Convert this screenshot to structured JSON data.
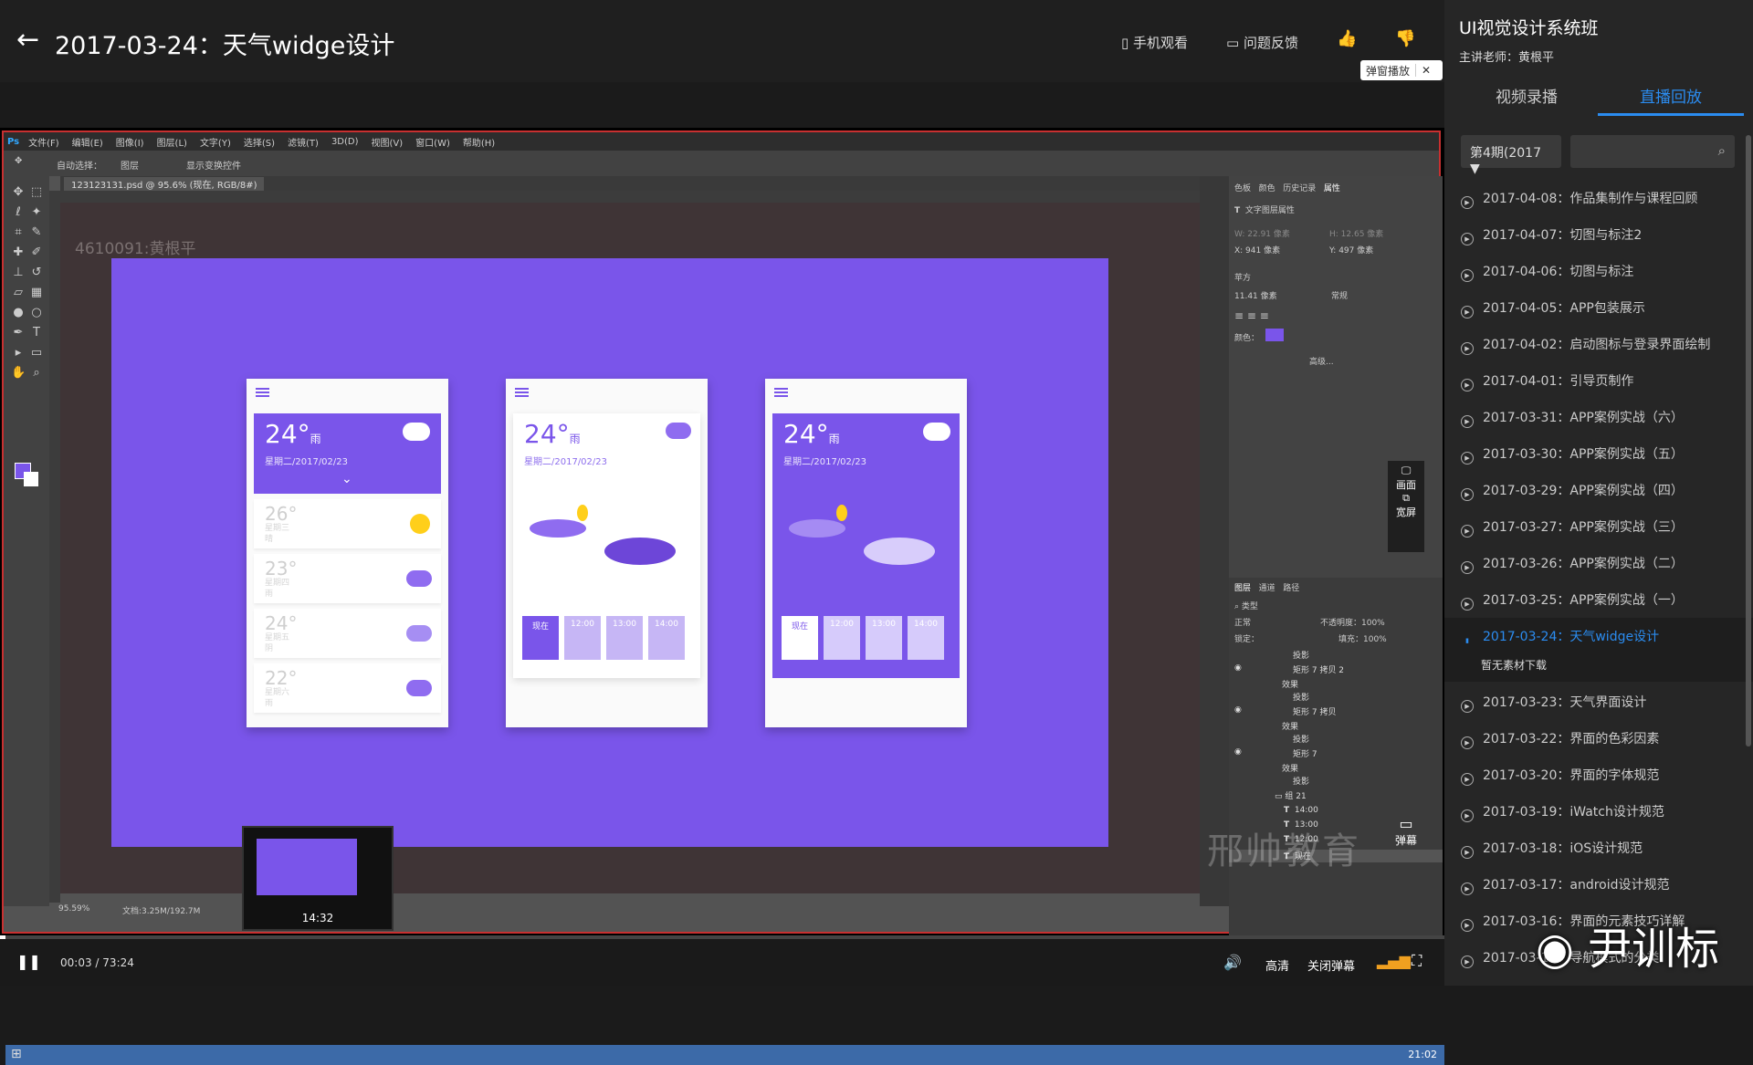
{
  "header": {
    "title": "2017-03-24：天气widge设计",
    "back_icon": "←",
    "mobile_watch": "手机观看",
    "feedback": "问题反馈",
    "danmu_popup": "弹窗播放",
    "close": "✕"
  },
  "ps": {
    "logo": "Ps",
    "menus": [
      "文件(F)",
      "编辑(E)",
      "图像(I)",
      "图层(L)",
      "文字(Y)",
      "选择(S)",
      "滤镜(T)",
      "3D(D)",
      "视图(V)",
      "窗口(W)",
      "帮助(H)"
    ],
    "auto_select": "自动选择：",
    "auto_select_value": "图层",
    "show_transform": "显示变换控件",
    "doc_tab": "123123131.psd @ 95.6% (现在, RGB/8#)",
    "user_watermark": "4610091:黄根平",
    "zoom": "95.59%",
    "doc_size": "文档:3.25M/192.7M",
    "panel_tabs": [
      "色板",
      "颜色",
      "历史记录",
      "属性"
    ],
    "prop_title": "文字图层属性",
    "w": "W: 22.91 像素",
    "h": "H: 12.65 像素",
    "x": "X: 941 像素",
    "y": "Y: 497 像素",
    "font_family": "苹方",
    "font_size": "11.41 像素",
    "font_style": "常规",
    "color_label": "颜色：",
    "advanced": "高级...",
    "layer_tabs": [
      "图层",
      "通道",
      "路径"
    ],
    "layer_kind": "类型",
    "blend": "正常",
    "opacity": "不透明度：100%",
    "lock": "锁定：",
    "fill": "填充：100%",
    "layers": [
      "投影",
      "矩形 7 拷贝 2",
      "效果",
      "投影",
      "矩形 7 拷贝",
      "效果",
      "投影",
      "矩形 7",
      "效果",
      "投影",
      "组 21",
      "14:00",
      "13:00",
      "12:00",
      "现在"
    ],
    "float_screen": "画面",
    "float_wide": "宽屏",
    "danmu": "弹幕",
    "brand_watermark": "邢帅教育",
    "tray_time": "21:02"
  },
  "phones": {
    "p1": {
      "temp": "24°",
      "unit": "雨",
      "date": "星期二/2017/02/23",
      "rows": [
        {
          "t": "26°",
          "s": "星期三",
          "w": "晴"
        },
        {
          "t": "23°",
          "s": "星期四",
          "w": "雨"
        },
        {
          "t": "24°",
          "s": "星期五",
          "w": "阴"
        },
        {
          "t": "22°",
          "s": "星期六",
          "w": "雨"
        }
      ]
    },
    "p2": {
      "temp": "24°",
      "unit": "雨",
      "date": "星期二/2017/02/23"
    },
    "p3": {
      "temp": "24°",
      "unit": "雨",
      "date": "星期二/2017/02/23"
    },
    "slots": [
      "现在",
      "12:00",
      "13:00",
      "14:00"
    ]
  },
  "thumb_time": "14:32",
  "player": {
    "current": "00:03",
    "separator": "/",
    "total": "73:24",
    "quality": "高清",
    "danmu_off": "关闭弹幕"
  },
  "sidebar": {
    "course": "UI视觉设计系统班",
    "teacher": "主讲老师：黄根平",
    "tab_video": "视频录播",
    "tab_live": "直播回放",
    "period": "第4期(2017",
    "no_material": "暂无素材下载",
    "episodes": [
      "2017-04-08：作品集制作与课程回顾",
      "2017-04-07：切图与标注2",
      "2017-04-06：切图与标注",
      "2017-04-05：APP包装展示",
      "2017-04-02：启动图标与登录界面绘制",
      "2017-04-01：引导页制作",
      "2017-03-31：APP案例实战（六）",
      "2017-03-30：APP案例实战（五）",
      "2017-03-29：APP案例实战（四）",
      "2017-03-27：APP案例实战（三）",
      "2017-03-26：APP案例实战（二）",
      "2017-03-25：APP案例实战（一）",
      "2017-03-24：天气widge设计",
      "2017-03-23：天气界面设计",
      "2017-03-22：界面的色彩因素",
      "2017-03-20：界面的字体规范",
      "2017-03-19：iWatch设计规范",
      "2017-03-18：iOS设计规范",
      "2017-03-17：android设计规范",
      "2017-03-16：界面的元素技巧详解",
      "2017-03-15：导航模式的分类"
    ]
  },
  "weibo_watermark": "尹训标",
  "colors": {
    "accent": "#2b8cf0",
    "purple": "#7a55ea",
    "sun": "#ffcf1a"
  }
}
